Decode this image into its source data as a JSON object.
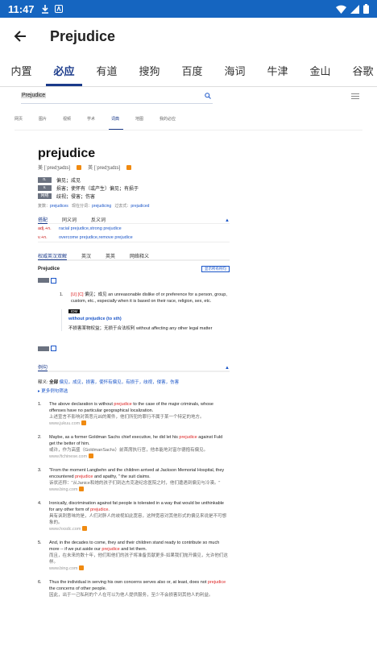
{
  "status": {
    "time": "11:47"
  },
  "appbar": {
    "title": "Prejudice"
  },
  "tabs": [
    "内置",
    "必应",
    "有道",
    "搜狗",
    "百度",
    "海词",
    "牛津",
    "金山",
    "谷歌"
  ],
  "active_tab_index": 1,
  "web": {
    "search_value": "Prejudice",
    "channels": [
      "网页",
      "图片",
      "视频",
      "学术",
      "词典",
      "地图",
      "我的必应"
    ],
    "active_channel_index": 4,
    "word": "prejudice",
    "phonetic_us": "美 [ˈpredʒədɪs]",
    "phonetic_uk": "英 [ˈpredʒudɪs]",
    "definitions": [
      {
        "pos": "n.",
        "text": "偏见；成见"
      },
      {
        "pos": "v.",
        "text": "损害；使怀有（或产生）偏见；有损于"
      },
      {
        "pos": "网络",
        "text": "歧视；侵害；伤害"
      }
    ],
    "forms": {
      "label_plural": "复数：",
      "plural": "prejudices",
      "label_ing": "现在分词：",
      "ing": "prejudicing",
      "label_past": "过去式：",
      "past": "prejudiced"
    },
    "collocation_tabs": [
      "搭配",
      "同义词",
      "反义词"
    ],
    "collocations": [
      {
        "k": "adj.+n.",
        "v": "racial prejudice,strong prejudice"
      },
      {
        "k": "v.+n.",
        "v": "overcome prejudice,remove prejudice"
      }
    ],
    "dict_tabs": [
      "权威英汉双解",
      "英汉",
      "英英",
      "网络释义"
    ],
    "dict_word": "Prejudice",
    "show_all_btn": "显示所有例句",
    "sense1_num": "1.",
    "sense1_tag": "[U] [C]",
    "sense1_cn": "偏见；成见",
    "sense1_en": "an unreasonable dislike of or preference for a person, group, custom, etc., especially when it is based on their race, religion, sex, etc.",
    "idm_tag": "IDM",
    "idm_phrase": "without prejudice (to sth)",
    "idm_cn": "不损害某物权益；无损于合法权利 without affecting any other legal matter",
    "examples_tab": "例句",
    "filter_label": "释义:",
    "filter_all": "全部",
    "filter_items": "偏见，成见，损害，使怀有偏见，有损于，歧视，侵害，伤害",
    "more_filter": "▸ 更多例句筛选",
    "examples": [
      {
        "n": "1.",
        "en1": "The above declaration is without ",
        "hl": "prejudice",
        "en2": " to the case of the major criminals, whose offenses have no particular geographical localization.",
        "cn": "上述宣言不影响对首恶元凶的案件，他们所犯的罪行不属于某一个特定的地方。",
        "src": "www.jukuu.com"
      },
      {
        "n": "2.",
        "en1": "Maybe, as a former Goldman Sachs chief executive, he did let his ",
        "hl": "prejudice",
        "en2": " against Fuld get the better of him.",
        "cn": "或许，作为高盛（GoldmanSachs）前首席执行官，他本能地对富尔德抱有偏见。",
        "src": "www.ftchinese.com"
      },
      {
        "n": "3.",
        "en1": "\"From the moment Langbehn and the children arrived at Jackson Memorial Hospital, they encountered ",
        "hl": "prejudice",
        "en2": " and apathy, \" the suit claims.",
        "cn": "诉状还称：\"从Janice和她的孩子们到达杰克逊纪念医院之时，他们遭遇到偏见与冷漠。\"",
        "src": "www.bing.com"
      },
      {
        "n": "4.",
        "en1": "Ironically, discrimination against fat people is tolerated in a way that would be unthinkable for any other form of ",
        "hl": "prejudice",
        "en2": ".",
        "cn": "具有讽刺意味的是，人们对胖人的歧视如此宽容，这种宽容对其他形式的偏见来说是不可想象的。",
        "src": "www.hxsdc.com"
      },
      {
        "n": "5.",
        "en1": "And, in the decades to come, they and their children stand ready to contribute so much more -- if we put aside our ",
        "hl": "prejudice",
        "en2": " and let them.",
        "cn": "而且，在未来的数十年，他们和他们的孩子将准备贡献更多-如果我们抛开偏见，允许他们这样。",
        "src": "www.bing.com"
      },
      {
        "n": "6.",
        "en1": "Thus the individual in serving his own concerns serves also or, at least, does not ",
        "hl": "prejudice",
        "en2": " the concerns of other people.",
        "cn": "因此，出于一己私利的个人在可以为他人提供服务，至少不会损害到其他人的利益。",
        "src": ""
      }
    ]
  }
}
